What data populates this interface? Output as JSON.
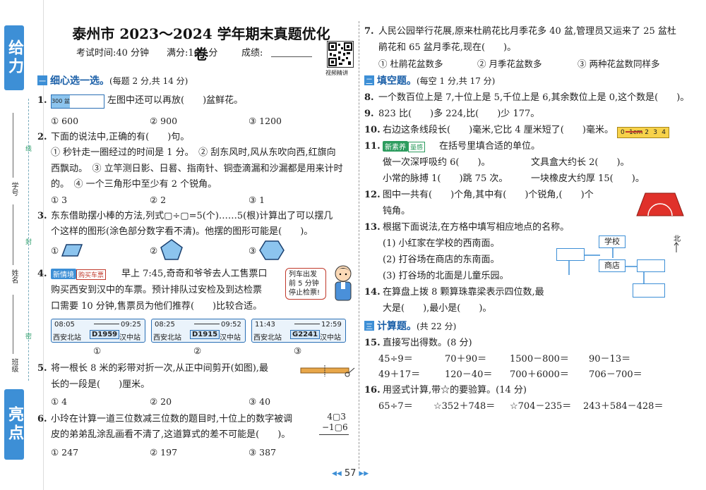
{
  "sidebar": {
    "tab_top": "给力",
    "tab_bottom": "亮点",
    "label_id": "学号",
    "label_name": "姓名",
    "label_class": "班级",
    "cut_marks": [
      "线",
      "封",
      "密"
    ]
  },
  "header": {
    "title": "泰州市 2023～2024 学年期末真题优化卷",
    "time_label": "考试时间:40 分钟",
    "score_label": "满分:100 分",
    "result_label": "成绩:",
    "qr_caption": "视频精讲"
  },
  "section1": {
    "badge": "一",
    "title": "细心选一选。",
    "note": "(每题 2 分,共 14 分)"
  },
  "q1": {
    "num": "1.",
    "bar_label": "300 盆",
    "text": "左图中还可以再放(　　)盆鲜花。",
    "options": [
      "① 600",
      "② 900",
      "③ 1200"
    ]
  },
  "q2": {
    "num": "2.",
    "lines": [
      "下面的说法中,正确的有(　　)句。",
      "① 秒针走一圈经过的时间是 1 分。　② 刮东风时,风从东吹向西,红旗向",
      "西飘动。　③ 立竿测日影、日晷、指南针、铜壶滴漏和沙漏都是用来计时",
      "的。　④ 一个三角形中至少有 2 个锐角。"
    ],
    "options": [
      "① 3",
      "② 2",
      "③ 1"
    ]
  },
  "q3": {
    "num": "3.",
    "lines": [
      "东东借助摆小棒的方法,列式▢÷▢=5(个)……5(根)计算出了可以摆几",
      "个这样的图形(涂色部分数字看不清)。他摆的图形可能是(　　)。"
    ],
    "options": [
      "①",
      "②",
      "③"
    ]
  },
  "q4": {
    "num": "4.",
    "tag1": "新情境",
    "tag2": "购买车票",
    "lines": [
      "早上 7:45,奇奇和爷爷去人工售票口",
      "购买西安到汉中的车票。预计排队过安检及到达检票",
      "口需要 10 分钟,售票员为他们推荐(　　)比较合适。"
    ],
    "bubble": [
      "列车出发",
      "前 5 分钟",
      "停止检票!"
    ],
    "tickets": [
      {
        "dep": "08:05",
        "arr": "09:25",
        "from": "西安北站",
        "train": "D1959",
        "to": "汉中站",
        "label": "①"
      },
      {
        "dep": "08:25",
        "arr": "09:52",
        "from": "西安北站",
        "train": "D1915",
        "to": "汉中站",
        "label": "②"
      },
      {
        "dep": "11:43",
        "arr": "12:59",
        "from": "西安北站",
        "train": "G2241",
        "to": "汉中站",
        "label": "③"
      }
    ]
  },
  "q5": {
    "num": "5.",
    "lines": [
      "将一根长 8 米的彩带对折一次,从正中间剪开(如图),最",
      "长的一段是(　　)厘米。"
    ],
    "options": [
      "① 4",
      "② 20",
      "③ 40"
    ]
  },
  "q6": {
    "num": "6.",
    "lines": [
      "小玲在计算一道三位数减三位数的题目时,十位上的数字被调",
      "皮的弟弟乱涂乱画看不清了,这道算式的差不可能是(　　)。"
    ],
    "calc_top": "4▢3",
    "calc_bottom": "−1▢6",
    "options": [
      "① 247",
      "② 197",
      "③ 387"
    ]
  },
  "q7": {
    "num": "7.",
    "lines": [
      "人民公园举行花展,原来杜鹃花比月季花多 40 盆,管理员又运来了 25 盆杜",
      "鹃花和 65 盆月季花,现在(　　)。"
    ],
    "options": [
      "① 杜鹃花盆数多",
      "② 月季花盆数多",
      "③ 两种花盆数同样多"
    ]
  },
  "section2": {
    "badge": "二",
    "title": "填空题。",
    "note": "(每空 1 分,共 17 分)"
  },
  "q8": {
    "num": "8.",
    "text": "一个数百位上是 7,十位上是 5,千位上是 6,其余数位上是 0,这个数是(　　)。"
  },
  "q9": {
    "num": "9.",
    "text": "823 比(　　)多 224,比(　　)少 177。"
  },
  "q10": {
    "num": "10.",
    "text": "右边这条线段长(　　)毫米,它比 4 厘米短了(　　)毫米。",
    "ruler": [
      "0",
      "1cm 2",
      "3",
      "4"
    ]
  },
  "q11": {
    "num": "11.",
    "tag1": "新素养",
    "tag2": "量感",
    "lines": [
      "在括号里填合适的单位。",
      "做一次深呼吸约 6(　　)。",
      "小常的脉搏 1(　　)跳 75 次。"
    ],
    "lines_right": [
      "文具盒大约长 2(　　)。",
      "一块橡皮大约厚 15(　　)。"
    ]
  },
  "q12": {
    "num": "12.",
    "lines": [
      "图中一共有(　　)个角,其中有(　　)个锐角,(　　)个",
      "钝角。"
    ]
  },
  "q13": {
    "num": "13.",
    "lines": [
      "根据下面说法,在方格中填写相应地点的名称。",
      "(1) 小红家在学校的西南面。",
      "(2) 打谷场在商店的东南面。",
      "(3) 打谷场的北面是儿童乐园。"
    ],
    "map_school": "学校",
    "map_store": "商店",
    "north": "北"
  },
  "q14": {
    "num": "14.",
    "lines": [
      "在算盘上拨 8 颗算珠靠梁表示四位数,最",
      "大是(　　),最小是(　　)。"
    ]
  },
  "section3": {
    "badge": "三",
    "title": "计算题。",
    "note": "(共 22 分)"
  },
  "q15": {
    "num": "15.",
    "title": "直接写出得数。(8 分)",
    "rows": [
      [
        "45÷9＝",
        "70＋90＝",
        "1500－800＝",
        "90－13＝"
      ],
      [
        "49＋17＝",
        "120－40＝",
        "700＋6000＝",
        "706－700＝"
      ]
    ]
  },
  "q16": {
    "num": "16.",
    "title": "用竖式计算,带☆的要验算。(14 分)",
    "items": [
      "65÷7＝",
      "☆352＋748＝",
      "☆704－235＝",
      "243＋584－428＝"
    ]
  },
  "footer": {
    "page": "57"
  },
  "colors": {
    "accent": "#3d8fd6",
    "section_text": "#1a5fa8",
    "tag_green": "#2c9c5e",
    "red_shape": "#e0312a"
  }
}
